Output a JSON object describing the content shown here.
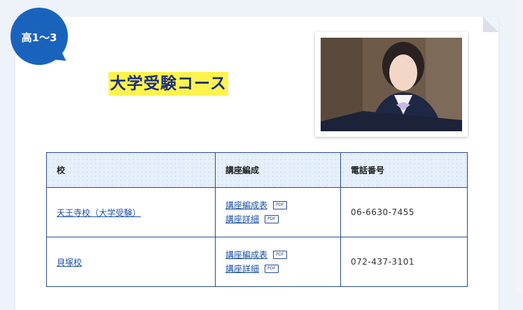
{
  "badge": {
    "label": "高1～3"
  },
  "course": {
    "title": "大学受験コース"
  },
  "table": {
    "headers": [
      "校",
      "講座編成",
      "電話番号"
    ],
    "rows": [
      {
        "school": "天王寺校（大学受験）",
        "link1": "講座編成表",
        "link2": "講座詳細",
        "pdf": "PDF",
        "phone": "06-6630-7455"
      },
      {
        "school": "貝塚校",
        "link1": "講座編成表",
        "link2": "講座詳細",
        "pdf": "PDF",
        "phone": "072-437-3101"
      }
    ]
  },
  "colors": {
    "badge": "#1a63bd",
    "highlight": "#fff34d",
    "title": "#1b2f7a",
    "border": "#2b4d8c",
    "link": "#1a4fa3"
  },
  "icons": {
    "photo": "student-photo"
  }
}
